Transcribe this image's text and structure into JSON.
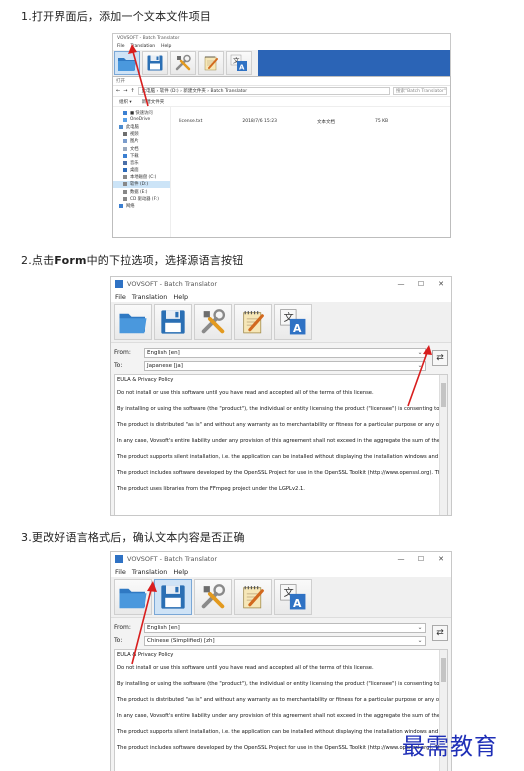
{
  "steps": [
    {
      "title": "1.打开界面后，添加一个文本文件项目"
    },
    {
      "title_pre": "2.点击",
      "title_bold": "Form",
      "title_post": "中的下拉选项，选择源语言按钮"
    },
    {
      "title": "3.更改好语言格式后，确认文本内容是否正确"
    }
  ],
  "app": {
    "title": "VOVSOFT - Batch Translator",
    "menu": [
      "File",
      "Translation",
      "Help"
    ],
    "window_controls": [
      "—",
      "☐",
      "✕"
    ],
    "toolbar_icons": [
      "folder-open-icon",
      "save-icon",
      "tools-icon",
      "notepad-icon",
      "translate-icon"
    ]
  },
  "explorer": {
    "title": "打开",
    "address": "此电脑 › 软件 (D:) › 新建文件夹 › Batch Translator",
    "search_placeholder": "搜索\"Batch Translator\"",
    "commands": [
      "组织 ▾",
      "新建文件夹"
    ],
    "nav_items": [
      "■ 快速访问",
      "OneDrive",
      "此电脑",
      "视频",
      "图片",
      "文档",
      "下载",
      "音乐",
      "桌面",
      "本地磁盘 (C:)",
      "软件 (D:)",
      "数据 (E:)",
      "CD 驱动器 (F:)",
      "网络"
    ],
    "file": {
      "name": "license.txt",
      "date": "2018/7/6 15:23",
      "type": "文本文档",
      "size": "75 KB"
    }
  },
  "window2": {
    "from_label": "From:",
    "to_label": "To:",
    "from_value": "English [en]",
    "to_value": "Japanese [ja]",
    "lines": [
      "EULA & Privacy Policy",
      "Do not install or use this software until you have read and accepted all of the terms of this license.",
      "By installing or using the software (the \"product\"), the individual or entity licensing the product (\"licensee\") is consenting to be bound by",
      "The product is distributed \"as is\" and without any warranty as to merchantability or fitness for a particular purpose or any other warrant",
      "In any case, Vovsoft's entire liability under any provision of this agreement shall not exceed in the aggregate the sum of the fees license",
      "The product supports silent installation, i.e. the application can be installed without displaying the installation windows and without show",
      "The product includes software developed by the OpenSSL Project for use in the OpenSSL Toolkit (http://www.openssl.org). The produc",
      "The product uses libraries from the FFmpeg project under the LGPLv2.1."
    ]
  },
  "window3": {
    "from_label": "From:",
    "to_label": "To:",
    "from_value": "English [en]",
    "to_value": "Chinese (Simplified) [zh]",
    "lines": [
      "EULA & Privacy Policy",
      "Do not install or use this software until you have read and accepted all of the terms of this license.",
      "By installing or using the software (the \"product\"), the individual or entity licensing the product (\"licensee\") is consenting to be bound by",
      "The product is distributed \"as is\" and without any warranty as to merchantability or fitness for a particular purpose or any other warrant",
      "In any case, Vovsoft's entire liability under any provision of this agreement shall not exceed in the aggregate the sum of the fees license",
      "The product supports silent installation, i.e. the application can be installed without displaying the installation windows and without show",
      "The product includes software developed by the OpenSSL Project for use in the OpenSSL Toolkit (http://www.openssl.org). The produc"
    ]
  },
  "watermark": "最需教育",
  "colors": {
    "arrow": "#d81e1e",
    "watermark": "#1f2fb7",
    "active_tool": "#cfe3f6"
  }
}
